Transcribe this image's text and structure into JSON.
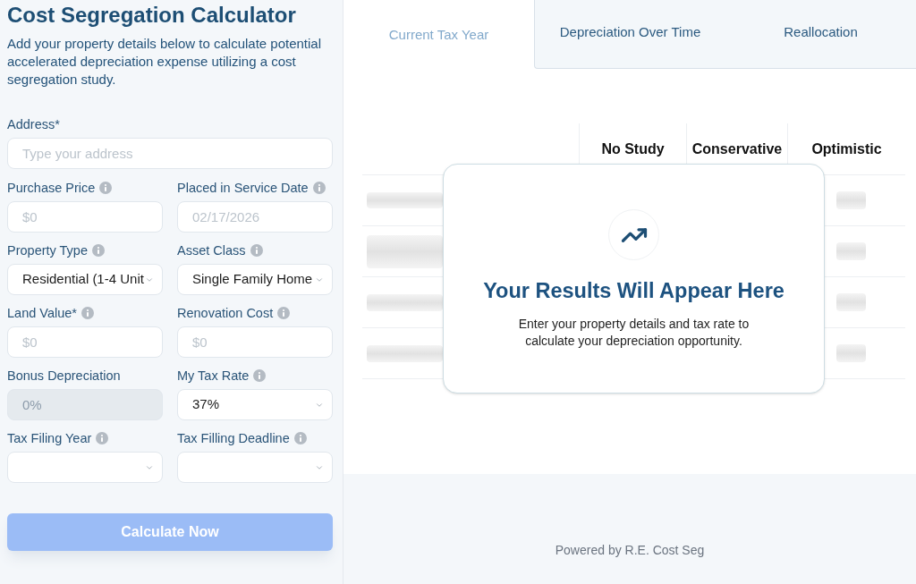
{
  "form": {
    "title": "Cost Segregation Calculator",
    "description": "Add your property details below to calculate potential accelerated depreciation expense utilizing a cost segregation study.",
    "address": {
      "label": "Address*",
      "info": false,
      "kind": "input",
      "disabled": false,
      "placeholder": "Type your address"
    },
    "fields": [
      {
        "label": "Purchase Price",
        "info": true,
        "kind": "input",
        "disabled": false,
        "placeholder": "$0"
      },
      {
        "label": "Placed in Service Date",
        "info": true,
        "kind": "input",
        "disabled": false,
        "placeholder": "02/17/2026"
      },
      {
        "label": "Property Type",
        "info": true,
        "kind": "select",
        "disabled": false,
        "value": "Residential (1-4 Unit"
      },
      {
        "label": "Asset Class",
        "info": true,
        "kind": "select",
        "disabled": false,
        "value": "Single Family Home"
      },
      {
        "label": "Land Value*",
        "info": true,
        "kind": "input",
        "disabled": false,
        "placeholder": "$0"
      },
      {
        "label": "Renovation Cost",
        "info": true,
        "kind": "input",
        "disabled": false,
        "placeholder": "$0"
      },
      {
        "label": "Bonus Depreciation",
        "info": false,
        "kind": "input",
        "disabled": true,
        "placeholder": "0%"
      },
      {
        "label": "My Tax Rate",
        "info": true,
        "kind": "select",
        "disabled": false,
        "value": "37%"
      },
      {
        "label": "Tax Filing Year",
        "info": true,
        "kind": "select",
        "disabled": false
      },
      {
        "label": "Tax Filling Deadline",
        "info": true,
        "kind": "select",
        "disabled": false
      }
    ],
    "submit": {
      "label": "Calculate Now",
      "disabled": true
    }
  },
  "tabs": [
    {
      "label": "Current Tax Year",
      "selected": true
    },
    {
      "label": "Depreciation Over Time",
      "selected": false
    },
    {
      "label": "Reallocation",
      "selected": false
    }
  ],
  "table": {
    "columns": [
      "No Study",
      "Conservative",
      "Optimistic"
    ]
  },
  "empty_state": {
    "title": "Your Results Will Appear Here",
    "message": "Enter your property details and tax rate to calculate your depreciation opportunity."
  },
  "footer": {
    "text": "Powered by R.E. Cost Seg"
  }
}
